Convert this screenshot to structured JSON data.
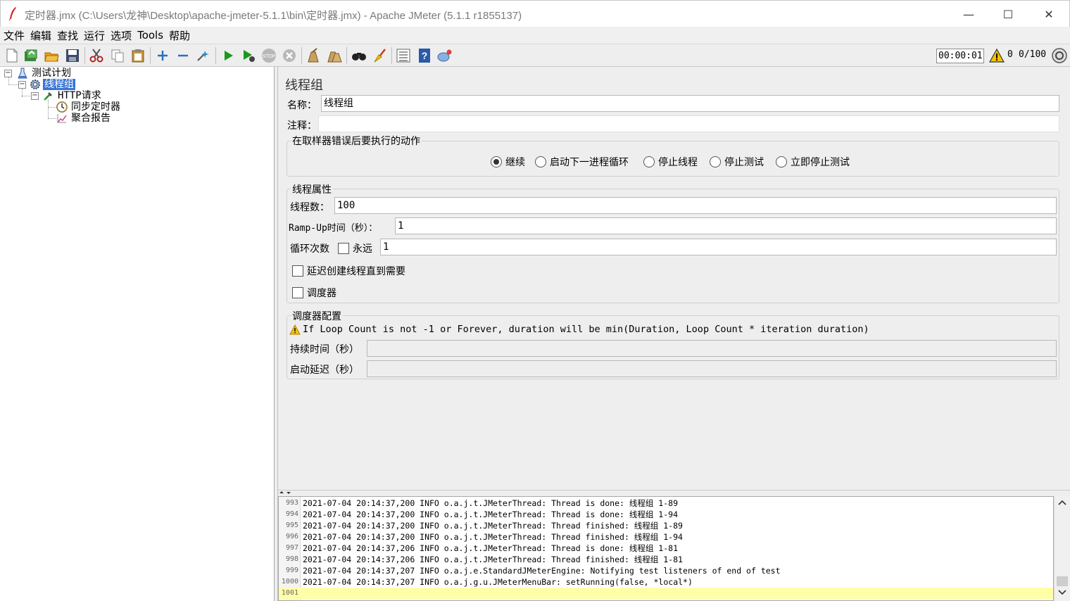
{
  "window": {
    "title": "定时器.jmx (C:\\Users\\龙神\\Desktop\\apache-jmeter-5.1.1\\bin\\定时器.jmx) - Apache JMeter (5.1.1 r1855137)",
    "minimize": "—",
    "maximize": "☐",
    "close": "✕"
  },
  "menu": [
    "文件",
    "编辑",
    "查找",
    "运行",
    "选项",
    "Tools",
    "帮助"
  ],
  "toolbar": {
    "timer": "00:00:01",
    "warnings": "0",
    "threads": "0/100",
    "icons": [
      "new-icon",
      "templates-icon",
      "open-icon",
      "save-icon",
      "cut-icon",
      "copy-icon",
      "paste-icon",
      "expand-icon",
      "collapse-icon",
      "toggle-icon",
      "start-icon",
      "start-no-pause-icon",
      "stop-icon",
      "shutdown-icon",
      "clear-icon",
      "clear-all-icon",
      "search-icon",
      "reset-search-icon",
      "function-helper-icon",
      "help-icon",
      "remote-icon"
    ]
  },
  "tree": {
    "root": "测试计划",
    "thread_group": "线程组",
    "sampler": "HTTP请求",
    "timer": "同步定时器",
    "listener": "聚合报告"
  },
  "panel": {
    "title": "线程组",
    "name_label": "名称：",
    "name_value": "线程组",
    "comment_label": "注释：",
    "comment_value": "",
    "error_group_title": "在取样器错误后要执行的动作",
    "error_actions": [
      "继续",
      "启动下一进程循环",
      "停止线程",
      "停止测试",
      "立即停止测试"
    ],
    "error_selected": 0,
    "thread_props_title": "线程属性",
    "threads_label": "线程数：",
    "threads_value": "100",
    "rampup_label": "Ramp-Up时间（秒）：",
    "rampup_value": "1",
    "loop_label": "循环次数",
    "forever_label": "永远",
    "loop_value": "1",
    "delay_label": "延迟创建线程直到需要",
    "scheduler_label": "调度器",
    "scheduler_group_title": "调度器配置",
    "scheduler_warning": "If Loop Count is not -1 or Forever, duration will be min(Duration, Loop Count * iteration duration)",
    "duration_label": "持续时间（秒）",
    "duration_value": "",
    "startup_delay_label": "启动延迟（秒）",
    "startup_delay_value": ""
  },
  "log": {
    "lines": [
      {
        "n": "993",
        "text": "2021-07-04 20:14:37,200 INFO o.a.j.t.JMeterThread: Thread is done: 线程组 1-89"
      },
      {
        "n": "994",
        "text": "2021-07-04 20:14:37,200 INFO o.a.j.t.JMeterThread: Thread is done: 线程组 1-94"
      },
      {
        "n": "995",
        "text": "2021-07-04 20:14:37,200 INFO o.a.j.t.JMeterThread: Thread finished: 线程组 1-89"
      },
      {
        "n": "996",
        "text": "2021-07-04 20:14:37,200 INFO o.a.j.t.JMeterThread: Thread finished: 线程组 1-94"
      },
      {
        "n": "997",
        "text": "2021-07-04 20:14:37,206 INFO o.a.j.t.JMeterThread: Thread is done: 线程组 1-81"
      },
      {
        "n": "998",
        "text": "2021-07-04 20:14:37,206 INFO o.a.j.t.JMeterThread: Thread finished: 线程组 1-81"
      },
      {
        "n": "999",
        "text": "2021-07-04 20:14:37,207 INFO o.a.j.e.StandardJMeterEngine: Notifying test listeners of end of test"
      },
      {
        "n": "1000",
        "text": "2021-07-04 20:14:37,207 INFO o.a.j.g.u.JMeterMenuBar: setRunning(false, *local*)"
      },
      {
        "n": "1001",
        "text": ""
      }
    ]
  },
  "colors": {
    "selection": "#3875d7",
    "panel_bg": "#eeeeee",
    "log_current_line": "#ffffa8",
    "start_green": "#1a9a1a",
    "warning_yellow": "#f5c400"
  }
}
